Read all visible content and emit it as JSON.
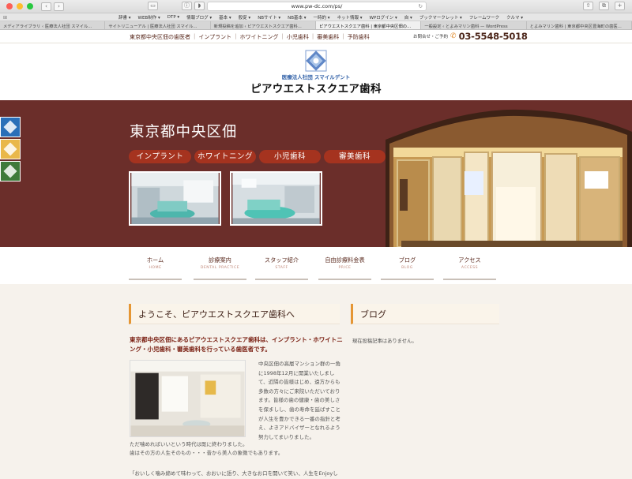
{
  "browser": {
    "url": "www.pw-dc.com/ps/",
    "bookmarks": [
      "辞書 ▾",
      "WEB制作 ▾",
      "DTP ▾",
      "情報ブログ ▾",
      "基本 ▾",
      "般促 ▾",
      "NBサイト ▾",
      "NB基本 ▾",
      "一時的 ▾",
      "ネット情報 ▾",
      "WPログイン ▾",
      "自 ▾",
      "ブックマークレット ▾",
      "フレームワーク",
      "クルマ ▾"
    ],
    "tabs": [
      {
        "label": "メディアライブラリ ‹ 医療法人社団 スマイル...",
        "active": false
      },
      {
        "label": "サイトリニューアル | 医療法人社団 スマイル...",
        "active": false
      },
      {
        "label": "新規投稿を追加 ‹ ピアウエストスクエア歯科...",
        "active": false
      },
      {
        "label": "ピアウエストスクエア歯科 | 東京都中央区佃の...",
        "active": true
      },
      {
        "label": "一般設定 ‹ とよみマリン歯科 — WordPress",
        "active": false
      },
      {
        "label": "とよみマリン歯科 | 東京都中央区豊海町の歯医...",
        "active": false
      }
    ]
  },
  "header": {
    "top_links": [
      "東京都中央区佃の歯医者",
      "インプラント",
      "ホワイトニング",
      "小児歯科",
      "審美歯科",
      "予防歯科"
    ],
    "contact_label": "お問合せ・ご予約",
    "phone": "03-5548-5018",
    "logo_sub": "医療法人社団 スマイルデント",
    "logo_main": "ピアウエストスクエア歯科"
  },
  "hero": {
    "title": "東京都中央区佃",
    "pills": [
      "インプラント",
      "ホワイトニング",
      "小児歯科",
      "審美歯科"
    ]
  },
  "nav": [
    {
      "jp": "ホーム",
      "en": "HOME"
    },
    {
      "jp": "診療案内",
      "en": "DENTAL PRACTICE"
    },
    {
      "jp": "スタッフ紹介",
      "en": "STAFF"
    },
    {
      "jp": "自由診療料金表",
      "en": "PRICE"
    },
    {
      "jp": "ブログ",
      "en": "BLOG"
    },
    {
      "jp": "アクセス",
      "en": "ACCESS"
    }
  ],
  "welcome": {
    "heading": "ようこそ、ピアウエストスクエア歯科へ",
    "lead": "東京都中央区佃にあるピアウエストスクエア歯科は、インプラント・ホワイトニング・小児歯科・審美歯科を行っている歯医者です。",
    "body": "中央区佃の高層マンション群の一角に1998年12月に開業いたしまして、近隣の皆様はじめ、遠方からも多数の方々にご来院いただいております。皆様の歯の健康・歯の美しさを保ましし、歯の寿命を延ばすことが人生を豊かできる一番の指針と考え、よきアドバイザーとなれるよう努力してまいりました。",
    "body2a": "ただ噛めればいいという時代は既に終わりました。",
    "body2b": "歯はその方の人生そのもの・・・昔から美人の象徴でもあります。",
    "body3": "「おいしく噛み締めて味わって、おおいに語り、大きなお口を開いて笑い、人生をEnjoyし"
  },
  "blog": {
    "heading": "ブログ",
    "empty": "現在投稿記事はありません。"
  },
  "colors": {
    "hero_bg": "#6b2e2a",
    "pill": "#a5331f",
    "accent": "#e59634",
    "side_blue": "#2a6fb8",
    "side_yellow": "#e9b84a",
    "side_green": "#3f7a3a"
  }
}
